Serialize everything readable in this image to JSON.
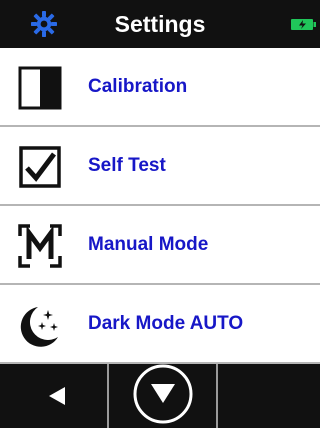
{
  "header": {
    "title": "Settings",
    "left_icon": "gear-icon",
    "right_icon": "battery-charging-icon",
    "accent_color": "#2a6ae6",
    "battery_color": "#20c65a"
  },
  "menu": {
    "items": [
      {
        "label": "Calibration",
        "icon": "calibration-icon"
      },
      {
        "label": "Self Test",
        "icon": "checkbox-checked-icon"
      },
      {
        "label": "Manual Mode",
        "icon": "manual-mode-icon"
      },
      {
        "label": "Dark Mode AUTO",
        "icon": "moon-stars-icon"
      }
    ],
    "label_color": "#1717c7"
  },
  "footer": {
    "buttons": [
      {
        "icon": "left-arrow-icon"
      },
      {
        "icon": "down-arrow-circle-icon"
      },
      {
        "icon": ""
      }
    ]
  }
}
